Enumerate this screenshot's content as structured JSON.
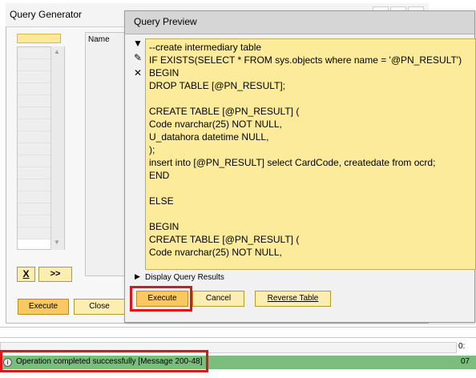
{
  "query_generator": {
    "title": "Query Generator",
    "name_header": "Name",
    "x_button": "X",
    "forward_button": ">>",
    "execute_button": "Execute",
    "close_button": "Close"
  },
  "query_preview": {
    "title": "Query Preview",
    "sql_lines": [
      "--create intermediary table",
      "IF EXISTS(SELECT * FROM sys.objects where name = '@PN_RESULT')",
      "BEGIN",
      "DROP TABLE [@PN_RESULT];",
      "",
      "CREATE TABLE [@PN_RESULT] (",
      "Code nvarchar(25) NOT NULL,",
      "U_datahora datetime NULL,",
      ");",
      "insert into [@PN_RESULT] select CardCode, createdate from ocrd;",
      "END",
      "",
      "ELSE",
      "",
      "BEGIN",
      "CREATE TABLE [@PN_RESULT] (",
      "Code nvarchar(25) NOT NULL,"
    ],
    "display_results_label": "Display Query Results",
    "execute_button": "Execute",
    "cancel_button": "Cancel",
    "reverse_table_button": "Reverse Table"
  },
  "status_bar": {
    "message": "Operation completed successfully  [Message 200-48]",
    "right_text": "07",
    "progress_right_text": "0:"
  },
  "colors": {
    "highlight_red": "#e0151c",
    "editor_bg": "#fbeb9a",
    "status_green": "#7bbd7d",
    "button_yellow": "#fbeeb0"
  }
}
